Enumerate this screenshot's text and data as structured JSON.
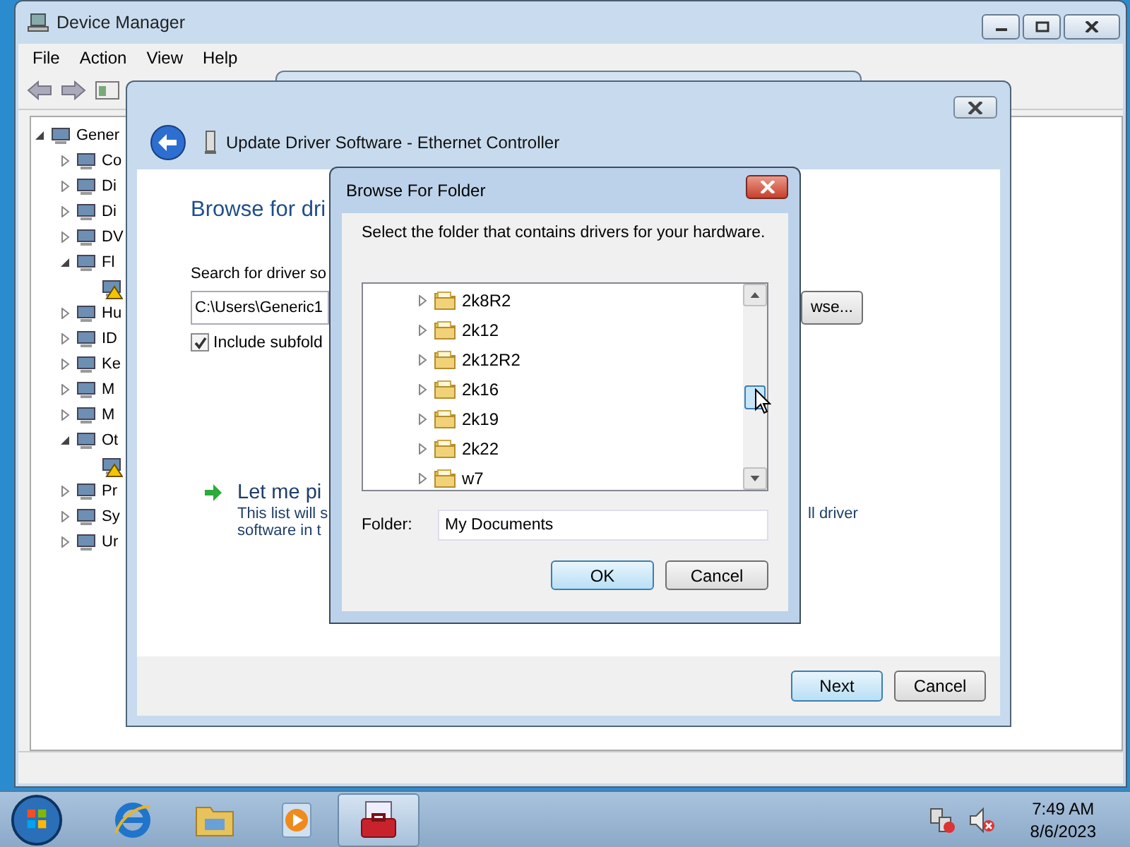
{
  "device_manager": {
    "title": "Device Manager",
    "menu": [
      "File",
      "Action",
      "View",
      "Help"
    ],
    "tree": {
      "label": "Gener",
      "expanded": true,
      "children": [
        {
          "label": "Co",
          "expanded": false
        },
        {
          "label": "Di",
          "expanded": false
        },
        {
          "label": "Di",
          "expanded": false
        },
        {
          "label": "DV",
          "expanded": false
        },
        {
          "label": "Fl",
          "expanded": true,
          "children": [
            {
              "warning": true
            }
          ]
        },
        {
          "label": "Hu",
          "expanded": false
        },
        {
          "label": "ID",
          "expanded": false
        },
        {
          "label": "Ke",
          "expanded": false
        },
        {
          "label": "M",
          "expanded": false
        },
        {
          "label": "M",
          "expanded": false
        },
        {
          "label": "Ot",
          "expanded": true,
          "children": [
            {
              "warning": true
            }
          ]
        },
        {
          "label": "Pr",
          "expanded": false
        },
        {
          "label": "Sy",
          "expanded": false
        },
        {
          "label": "Ur",
          "expanded": false
        }
      ]
    }
  },
  "update_driver": {
    "title": "Update Driver Software - Ethernet Controller",
    "heading": "Browse for dri",
    "search_label": "Search for driver so",
    "path": "C:\\Users\\Generic1",
    "include_subfolders": {
      "label": "Include subfold",
      "checked": true
    },
    "browse_button": "wse...",
    "pick_option": {
      "title": "Let me pi",
      "line_1": "This list will s",
      "line_1_end": "ll driver",
      "line_2": "software in t"
    },
    "buttons": [
      {
        "label": "Next",
        "default": true
      },
      {
        "label": "Cancel",
        "default": false
      }
    ]
  },
  "browse_dialog": {
    "title": "Browse For Folder",
    "instruction": "Select the folder that contains drivers for your hardware.",
    "folders": [
      {
        "label": "2k8R2",
        "expanded": false
      },
      {
        "label": "2k12",
        "expanded": false
      },
      {
        "label": "2k12R2",
        "expanded": false
      },
      {
        "label": "2k16",
        "expanded": false
      },
      {
        "label": "2k19",
        "expanded": false
      },
      {
        "label": "2k22",
        "expanded": false
      },
      {
        "label": "w7",
        "expanded": false
      }
    ],
    "folder_label": "Folder:",
    "folder_value": "My Documents",
    "buttons": [
      {
        "label": "OK",
        "default": true
      },
      {
        "label": "Cancel",
        "default": false
      }
    ]
  },
  "taskbar": {
    "apps": [
      {
        "kind": "browser",
        "selected": false
      },
      {
        "kind": "folder",
        "selected": false
      },
      {
        "kind": "media",
        "selected": false
      },
      {
        "kind": "toolbox",
        "selected": true
      }
    ],
    "time": "7:49 AM",
    "date": "8/6/2023"
  }
}
